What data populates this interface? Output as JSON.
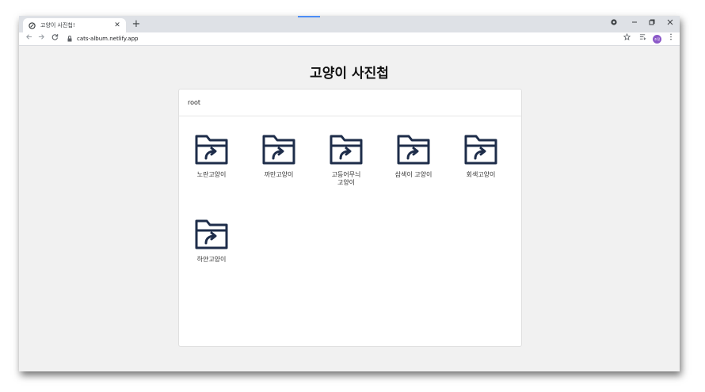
{
  "browser": {
    "tab_title": "고양이 사진첩!",
    "close_glyph": "✕",
    "new_tab_glyph": "+",
    "url": "cats-album.netlify.app",
    "avatar_text": "조정"
  },
  "page": {
    "title": "고양이 사진첩"
  },
  "breadcrumb": [
    "root"
  ],
  "nodes": [
    {
      "name": "노란고양이",
      "type": "DIRECTORY"
    },
    {
      "name": "까만고양이",
      "type": "DIRECTORY"
    },
    {
      "name": "고등어무늬 고양이",
      "type": "DIRECTORY"
    },
    {
      "name": "삼색이 고양이",
      "type": "DIRECTORY"
    },
    {
      "name": "회색고양이",
      "type": "DIRECTORY"
    },
    {
      "name": "하얀고양이",
      "type": "DIRECTORY"
    }
  ],
  "colors": {
    "folder_icon": "#1e2d4a",
    "avatar": "#8b58c8",
    "loading": "#4c8df6"
  },
  "icons": {
    "folder": "folder-shortcut-icon",
    "favicon": "globe-icon",
    "lock": "lock-icon"
  }
}
